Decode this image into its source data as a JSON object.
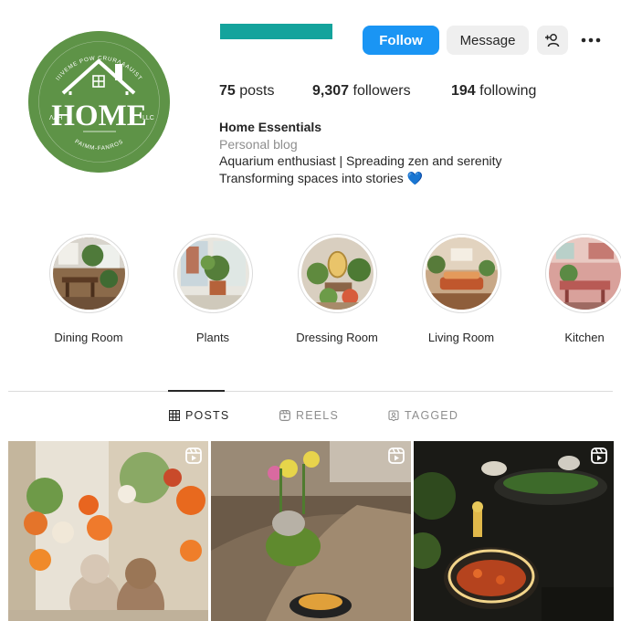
{
  "profile": {
    "username": "",
    "follow_label": "Follow",
    "message_label": "Message",
    "add_user_icon": "add-user-icon",
    "more_icon": "more-options-icon",
    "avatar_text": {
      "main": "HOME",
      "top_arc": "IIIVEME POW CRURɅAAUIST",
      "bottom_arc": "PAIMM-FANROS",
      "left": "ɅɅH",
      "right": "LLC"
    }
  },
  "stats": {
    "posts_count": "75",
    "posts_label": "posts",
    "followers_count": "9,307",
    "followers_label": "followers",
    "following_count": "194",
    "following_label": "following"
  },
  "bio": {
    "name": "Home Essentials",
    "category": "Personal blog",
    "line1": "Aquarium enthusiast | Spreading zen and serenity",
    "line2": "Transforming spaces into stories",
    "emoji": "💙"
  },
  "highlights": [
    {
      "label": "Dining Room"
    },
    {
      "label": "Plants"
    },
    {
      "label": "Dressing Room"
    },
    {
      "label": "Living Room"
    },
    {
      "label": "Kitchen"
    }
  ],
  "tabs": [
    {
      "label": "POSTS",
      "icon": "grid-icon",
      "active": true
    },
    {
      "label": "REELS",
      "icon": "reels-icon",
      "active": false
    },
    {
      "label": "TAGGED",
      "icon": "tagged-icon",
      "active": false
    }
  ],
  "posts": [
    {
      "type": "reel",
      "icon": "reel-badge-icon"
    },
    {
      "type": "reel",
      "icon": "reel-badge-icon"
    },
    {
      "type": "reel",
      "icon": "reel-badge-icon"
    }
  ],
  "colors": {
    "follow_button": "#1a95f4",
    "username_bar": "#14a39c",
    "avatar_bg": "#5e9347",
    "secondary_button": "#efefef",
    "muted_text": "#8e8e8e"
  }
}
